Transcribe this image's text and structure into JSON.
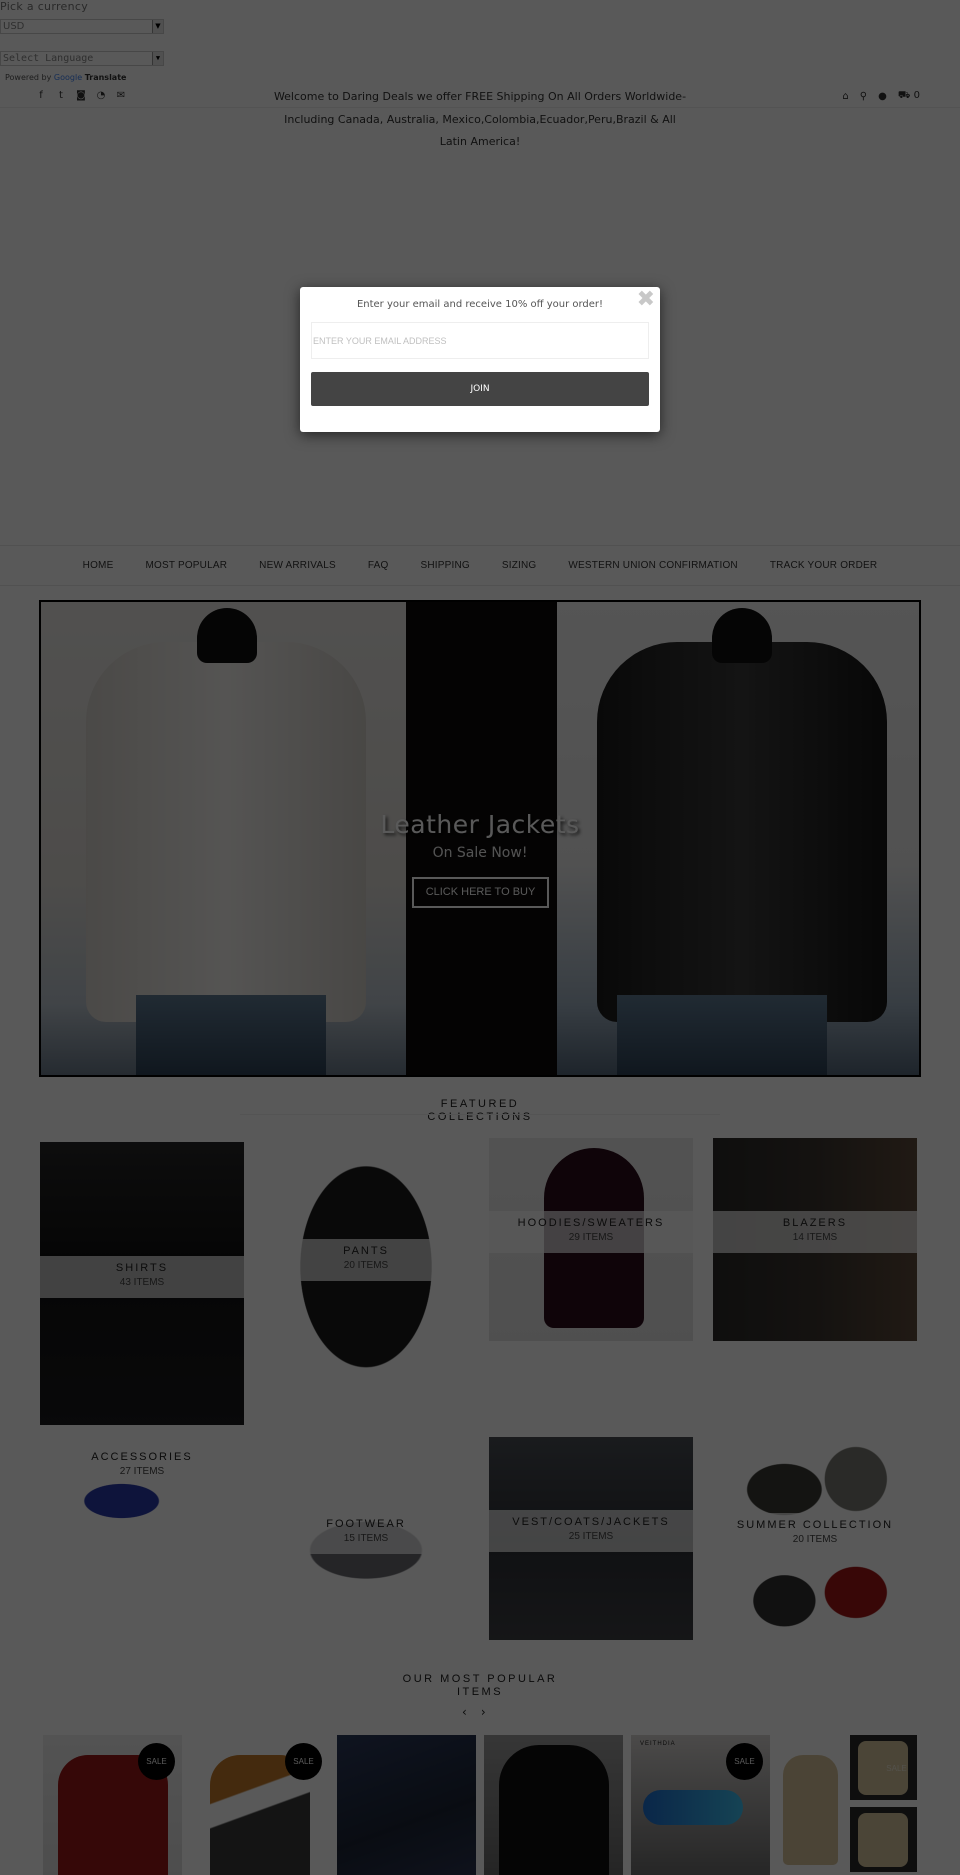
{
  "currency": {
    "label": "Pick a currency",
    "selected": "USD"
  },
  "language": {
    "selected": "Select Language",
    "powered_by": "Powered by",
    "google": "Google",
    "translate": "Translate"
  },
  "social_icons": [
    "facebook-icon",
    "twitter-icon",
    "instagram-icon",
    "rss-icon",
    "email-icon"
  ],
  "social_glyphs": [
    "f",
    "🐦",
    "◙",
    "◉",
    "✉"
  ],
  "welcome_message": "Welcome to Daring Deals we offer FREE Shipping On All Orders Worldwide- Including Canada, Australia, Mexico,Colombia,Ecuador,Peru,Brazil & All Latin America!",
  "header_icons": {
    "home": "⌂",
    "search": "⚲",
    "account": "👤",
    "cart": "🛒",
    "cart_count": "0"
  },
  "nav": {
    "items": [
      {
        "label": "HOME"
      },
      {
        "label": "MOST POPULAR"
      },
      {
        "label": "NEW ARRIVALS"
      },
      {
        "label": "FAQ"
      },
      {
        "label": "SHIPPING"
      },
      {
        "label": "SIZING"
      },
      {
        "label": "WESTERN UNION CONFIRMATION"
      },
      {
        "label": "TRACK YOUR ORDER"
      }
    ]
  },
  "hero": {
    "title": "Leather Jackets",
    "subtitle": "On Sale Now!",
    "cta": "CLICK HERE TO BUY"
  },
  "featured": {
    "title_line1": "FEATURED",
    "title_line2": "COLLECTIONS",
    "collections": [
      {
        "name": "SHIRTS",
        "count": "43 ITEMS"
      },
      {
        "name": "PANTS",
        "count": "20 ITEMS"
      },
      {
        "name": "HOODIES/SWEATERS",
        "count": "29 ITEMS"
      },
      {
        "name": "BLAZERS",
        "count": "14 ITEMS"
      },
      {
        "name": "ACCESSORIES",
        "count": "27 ITEMS"
      },
      {
        "name": "FOOTWEAR",
        "count": "15 ITEMS"
      },
      {
        "name": "VEST/COATS/JACKETS",
        "count": "25 ITEMS"
      },
      {
        "name": "SUMMER COLLECTION",
        "count": "20 ITEMS"
      }
    ]
  },
  "popular": {
    "title_line1": "OUR MOST POPULAR",
    "title_line2": "ITEMS",
    "prev": "‹",
    "next": "›",
    "sale_label": "SALE",
    "brand_mark": "VEITHDIA"
  },
  "modal": {
    "message": "Enter your email and receive 10% off your order!",
    "email_placeholder": "ENTER YOUR EMAIL ADDRESS",
    "email_value": "",
    "join_label": "JOIN",
    "close_glyph": "✖"
  }
}
